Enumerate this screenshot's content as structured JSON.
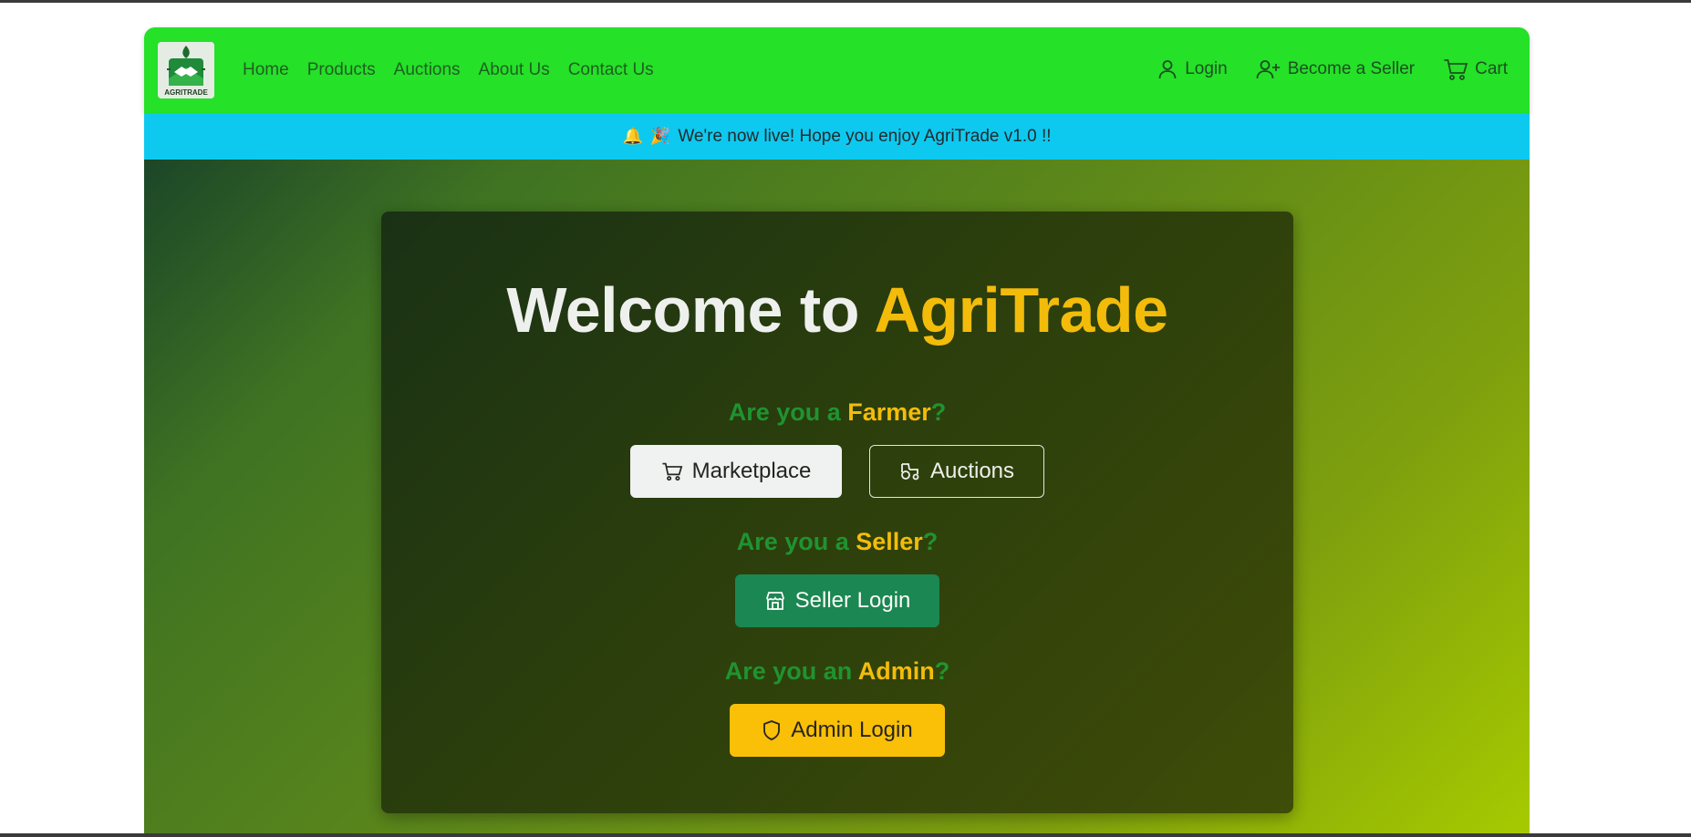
{
  "navbar": {
    "logo_text": "AGRITRADE",
    "links": [
      "Home",
      "Products",
      "Auctions",
      "About Us",
      "Contact Us"
    ],
    "login_label": "Login",
    "become_seller_label": "Become a Seller",
    "cart_label": "Cart"
  },
  "announcement": {
    "icons": [
      "🔔",
      "🎉"
    ],
    "text": "We're now live! Hope you enjoy AgriTrade v1.0 !!"
  },
  "hero": {
    "title_prefix": "Welcome to ",
    "title_brand": "AgriTrade",
    "farmer": {
      "prefix": "Are you a ",
      "role": "Farmer",
      "suffix": "?",
      "marketplace_label": "Marketplace",
      "auctions_label": "Auctions"
    },
    "seller": {
      "prefix": "Are you a ",
      "role": "Seller",
      "suffix": "?",
      "login_label": "Seller Login"
    },
    "admin": {
      "prefix": "Are you an ",
      "role": "Admin",
      "suffix": "?",
      "login_label": "Admin Login"
    }
  },
  "colors": {
    "navbar": "#25e128",
    "announcement": "#0ec9ef",
    "brand_yellow": "#f8be0b",
    "question_green": "#1e9432",
    "seller_button": "#198754",
    "admin_button": "#ffc107"
  }
}
